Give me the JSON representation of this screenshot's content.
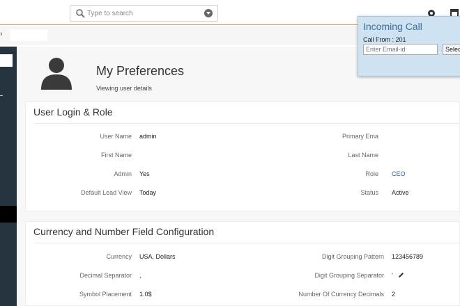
{
  "topbar": {
    "search_placeholder": "Type to search",
    "icons": [
      "search-icon",
      "dropdown-icon",
      "notification-icon",
      "calendar-icon"
    ]
  },
  "breadcrumb": {
    "chevron": "›"
  },
  "header": {
    "title": "My Preferences",
    "subtitle": "Viewing user details"
  },
  "user_login": {
    "title": "User Login & Role",
    "left_fields": [
      {
        "label": "User Name",
        "value": "admin"
      },
      {
        "label": "First Name",
        "value": ""
      },
      {
        "label": "Admin",
        "value": "Yes"
      },
      {
        "label": "Default Lead View",
        "value": "Today"
      }
    ],
    "right_fields": [
      {
        "label": "Primary Ema",
        "value": ""
      },
      {
        "label": "Last Name",
        "value": ""
      },
      {
        "label": "Role",
        "value": "CEO"
      },
      {
        "label": "Status",
        "value": "Active"
      }
    ]
  },
  "currency": {
    "title": "Currency and Number Field Configuration",
    "left_fields": [
      {
        "label": "Currency",
        "value": "USA, Dollars"
      },
      {
        "label": "Decimal Separator",
        "value": ","
      },
      {
        "label": "Symbol Placement",
        "value": "1.0$"
      }
    ],
    "right_fields": [
      {
        "label": "Digit Grouping Pattern",
        "value": "123456789"
      },
      {
        "label": "Digit Grouping Separator",
        "value": "'"
      },
      {
        "label": "Number Of Currency Decimals",
        "value": "2"
      }
    ]
  },
  "incoming_call": {
    "title": "Incoming Call",
    "from": "Call From : 201",
    "email_placeholder": "Enter Email-id",
    "select_label": "Selec"
  },
  "colors": {
    "sidebar": "#263440",
    "accent_line": "#e0a070",
    "popup_bg": "#cfe2f1",
    "popup_title": "#3a6f9e",
    "link": "#2a5fa0"
  }
}
